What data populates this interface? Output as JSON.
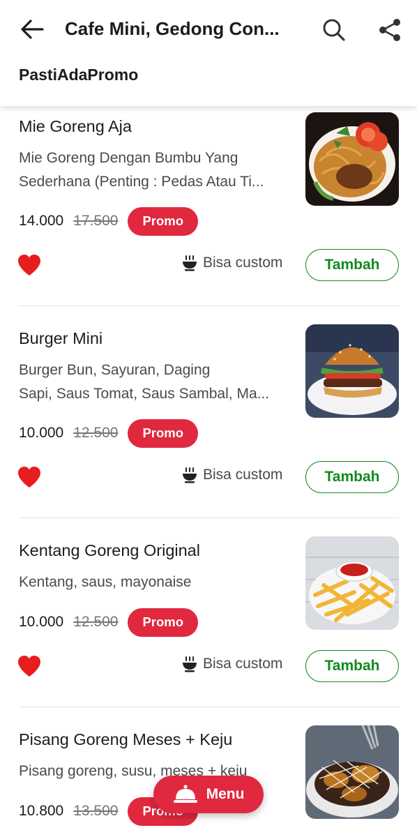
{
  "header": {
    "title": "Cafe Mini, Gedong Con...",
    "subtitle": "PastiAdaPromo",
    "back_icon": "arrow-left-icon",
    "search_icon": "search-icon",
    "share_icon": "share-icon"
  },
  "items": [
    {
      "name": "Mie Goreng Aja",
      "desc_line1": "Mie Goreng Dengan Bumbu Yang",
      "desc_line2": "Sederhana (Penting : Pedas Atau Ti...",
      "price": "14.000",
      "old_price": "17.500",
      "promo": "Promo",
      "custom": "Bisa custom",
      "add": "Tambah"
    },
    {
      "name": "Burger Mini",
      "desc_line1": "Burger Bun, Sayuran, Daging",
      "desc_line2": "Sapi, Saus Tomat, Saus Sambal, Ma...",
      "price": "10.000",
      "old_price": "12.500",
      "promo": "Promo",
      "custom": "Bisa custom",
      "add": "Tambah"
    },
    {
      "name": "Kentang Goreng Original",
      "desc_line1": "Kentang, saus, mayonaise",
      "price": "10.000",
      "old_price": "12.500",
      "promo": "Promo",
      "custom": "Bisa custom",
      "add": "Tambah"
    },
    {
      "name": "Pisang Goreng Meses + Keju",
      "desc_line1": "Pisang goreng, susu, meses + keju",
      "price": "10.800",
      "old_price": "13.500",
      "promo": "Promo"
    }
  ],
  "fab": {
    "label": "Menu",
    "icon": "food-cloche-icon"
  },
  "colors": {
    "accent_red": "#e0283e",
    "accent_green": "#118a1f",
    "text": "#1c1c1c"
  }
}
